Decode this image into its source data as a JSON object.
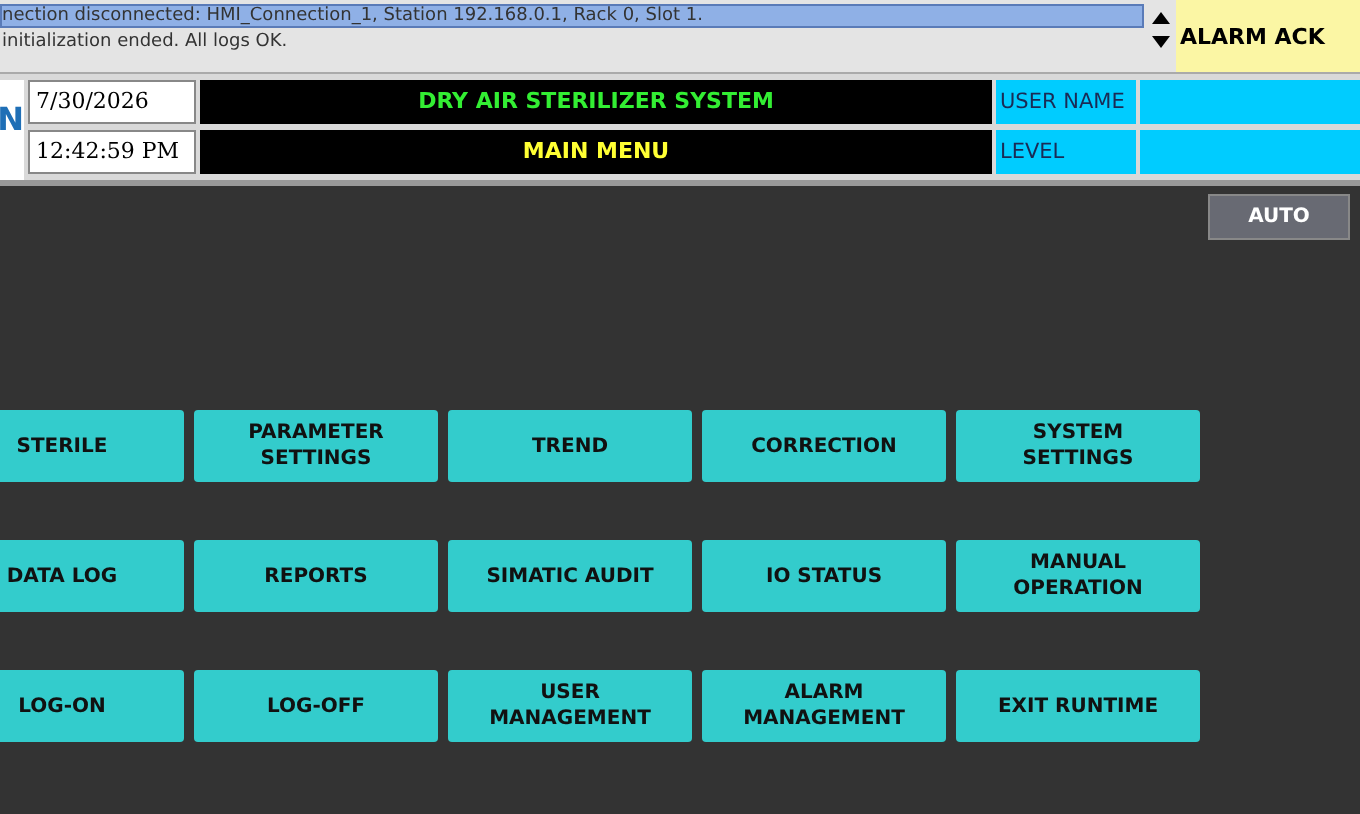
{
  "alarms": [
    {
      "text": "nection disconnected: HMI_Connection_1, Station 192.168.0.1, Rack 0, Slot 1.",
      "selected": true
    },
    {
      "text": "initialization ended. All logs OK.",
      "selected": false
    }
  ],
  "alarm_ack": "ALARM ACK",
  "logo": "N",
  "date": "7/30/2026",
  "time": "12:42:59 PM",
  "title": "DRY AIR STERILIZER SYSTEM",
  "screen": "MAIN MENU",
  "user_name_label": "USER NAME",
  "level_label": "LEVEL",
  "mode_button": "AUTO",
  "menu_rows": [
    [
      "STERILE",
      "PARAMETER SETTINGS",
      "TREND",
      "CORRECTION",
      "SYSTEM SETTINGS"
    ],
    [
      "DATA LOG",
      "REPORTS",
      "SIMATIC AUDIT",
      "IO STATUS",
      "MANUAL OPERATION"
    ],
    [
      "LOG-ON",
      "LOG-OFF",
      "USER MANAGEMENT",
      "ALARM MANAGEMENT",
      "EXIT RUNTIME"
    ]
  ]
}
